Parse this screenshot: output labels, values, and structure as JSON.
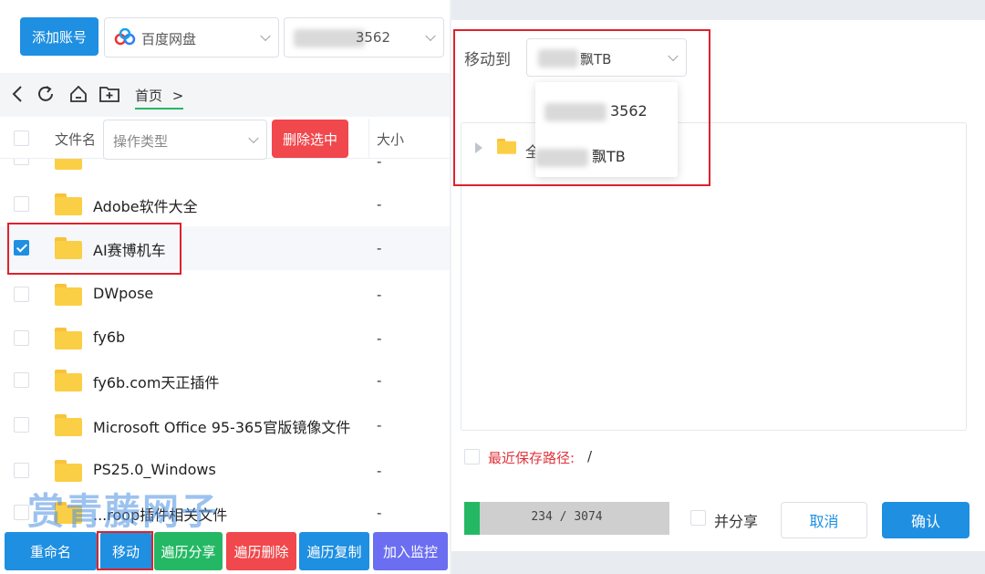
{
  "toolbar": {
    "add_account": "添加账号",
    "cloud_select": "百度网盘",
    "account_suffix": "3562"
  },
  "nav": {
    "breadcrumb": "首页",
    "breadcrumb_arrow": ">"
  },
  "table": {
    "col_name": "文件名",
    "op_type_placeholder": "操作类型",
    "delete_selected": "删除选中",
    "col_size": "大小",
    "rows": [
      {
        "name": "Adobe软件大全",
        "size": "-",
        "checked": false
      },
      {
        "name": "AI赛博机车",
        "size": "-",
        "checked": true
      },
      {
        "name": "DWpose",
        "size": "-",
        "checked": false
      },
      {
        "name": "fy6b",
        "size": "-",
        "checked": false
      },
      {
        "name": "fy6b.com天正插件",
        "size": "-",
        "checked": false
      },
      {
        "name": "Microsoft Office 95-365官版镜像文件",
        "size": "-",
        "checked": false
      },
      {
        "name": "PS25.0_Windows",
        "size": "-",
        "checked": false
      },
      {
        "name": "...roop插件相关文件",
        "size": "-",
        "checked": false
      }
    ]
  },
  "actions": {
    "rename": "重命名",
    "move": "移动",
    "traverse_share": "遍历分享",
    "traverse_delete": "遍历删除",
    "traverse_copy": "遍历复制",
    "add_monitor": "加入监控"
  },
  "watermark": "赏青藤网子",
  "dialog": {
    "move_to_label": "移动到",
    "target_suffix": "飘TB",
    "dropdown_options": [
      "3562",
      "飘TB"
    ],
    "tree_root_char": "全",
    "recent_path_label": "最近保存路径:",
    "recent_path_value": "/",
    "progress_text": "234 / 3074",
    "progress_fraction": 0.076,
    "and_share": "并分享",
    "cancel": "取消",
    "confirm": "确认"
  },
  "colors": {
    "primary": "#1e8fe1",
    "green": "#25b864",
    "red": "#f0484d",
    "purple": "#6b6ef0",
    "highlight": "#e0212b"
  }
}
